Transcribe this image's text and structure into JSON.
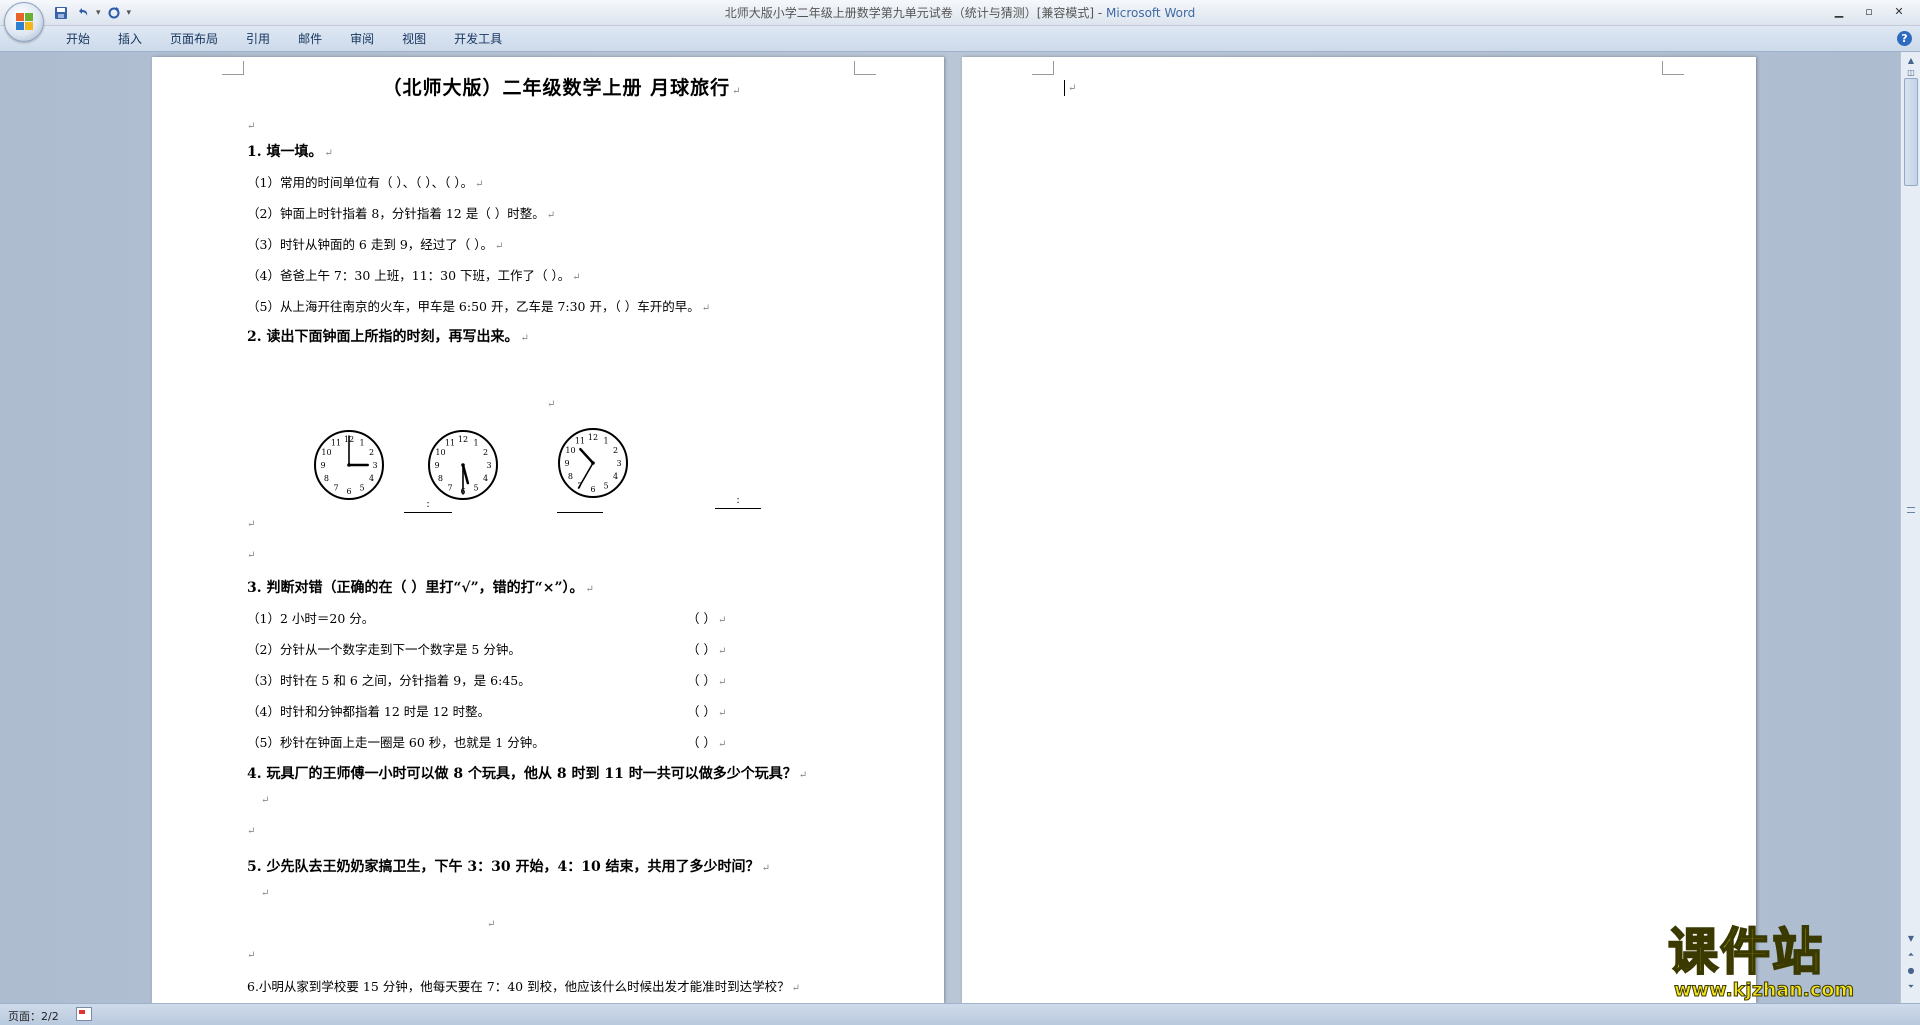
{
  "window": {
    "title": "北师大版小学二年级上册数学第九单元试卷（统计与猜测）[兼容模式]",
    "app_name": "Microsoft Word",
    "separator": " - "
  },
  "ribbon": {
    "tabs": [
      "开始",
      "插入",
      "页面布局",
      "引用",
      "邮件",
      "审阅",
      "视图",
      "开发工具"
    ]
  },
  "document": {
    "title": "（北师大版）二年级数学上册 月球旅行",
    "mark": "↵",
    "q1": {
      "head": "1. 填一填。",
      "items": [
        "（1）常用的时间单位有（    ）、（    ）、（    ）。",
        "（2）钟面上时针指着 8，分针指着 12 是（    ）时整。",
        "（3）时针从钟面的 6 走到 9，经过了（    ）。",
        "（4）爸爸上午 7：30 上班，11：30 下班，工作了（    ）。",
        "（5）从上海开往南京的火车，甲车是 6:50 开，乙车是 7:30 开，（    ）车开的早。"
      ]
    },
    "q2": {
      "head": "2. 读出下面钟面上所指的时刻，再写出来。",
      "blank_colon": ":"
    },
    "q3": {
      "head": "3. 判断对错（正确的在（  ）里打“√”，错的打“×”）。",
      "items": [
        "（1）2 小时＝20 分。",
        "（2）分针从一个数字走到下一个数字是 5 分钟。",
        "（3）时针在 5 和 6 之间，分针指着 9，是 6:45。",
        "（4）时针和分钟都指着 12 时是 12 时整。",
        "（5）秒针在钟面上走一圈是 60 秒，也就是 1 分钟。"
      ],
      "paren": "（      ）"
    },
    "q4": {
      "head": "4. 玩具厂的王师傅一小时可以做 8 个玩具，他从 8 时到 11 时一共可以做多少个玩具？"
    },
    "q5": {
      "head": "5. 少先队去王奶奶家搞卫生，下午 3：30 开始，4：10 结束，共用了多少时间？"
    },
    "q6": {
      "text": "6.小明从家到学校要 15 分钟，他每天要在 7：40 到校，他应该什么时候出发才能准时到达学校？"
    }
  },
  "clocks": [
    {
      "hour": 3,
      "minute": 0
    },
    {
      "hour": 5,
      "minute": 30
    },
    {
      "hour": 10,
      "minute": 35
    }
  ],
  "statusbar": {
    "page": "页面：2/2"
  },
  "watermark": {
    "name": "课件站",
    "url": "www.kjzhan.com"
  },
  "colors": {
    "accent": "#3f6aa3",
    "watermark": "#f4e21c"
  }
}
